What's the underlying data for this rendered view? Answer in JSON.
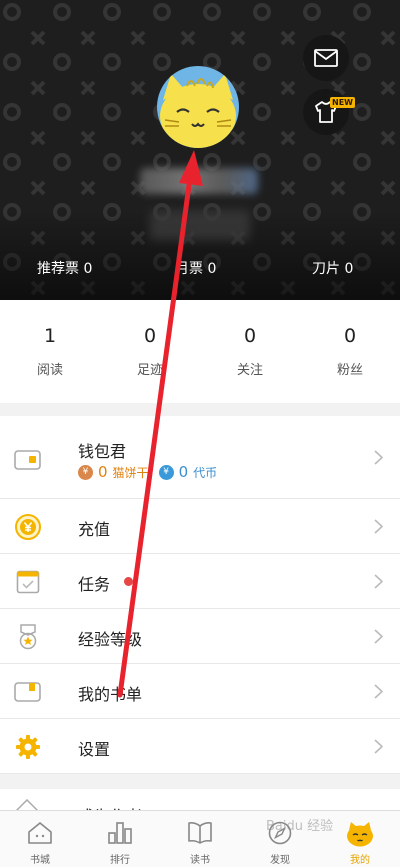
{
  "header": {
    "mail_icon": "envelope-icon",
    "wardrobe_icon": "tshirt-icon",
    "wardrobe_badge": "NEW",
    "tickets": [
      {
        "label": "推荐票",
        "value": "0"
      },
      {
        "label": "月票",
        "value": "0"
      },
      {
        "label": "刀片",
        "value": "0"
      }
    ]
  },
  "stats": [
    {
      "value": "1",
      "label": "阅读"
    },
    {
      "value": "0",
      "label": "足迹"
    },
    {
      "value": "0",
      "label": "关注"
    },
    {
      "value": "0",
      "label": "粉丝"
    }
  ],
  "menu": {
    "wallet": {
      "label": "钱包君",
      "cat_coin_value": "0",
      "cat_coin_label": "猫饼干",
      "dai_coin_value": "0",
      "dai_coin_label": "代币",
      "coin_glyph": "¥"
    },
    "recharge": "充值",
    "tasks": "任务",
    "level": "经验等级",
    "booklist": "我的书单",
    "settings": "设置",
    "partial": "成为作者"
  },
  "tabbar": [
    {
      "label": "书城",
      "icon": "house-icon"
    },
    {
      "label": "排行",
      "icon": "bars-icon"
    },
    {
      "label": "读书",
      "icon": "book-icon"
    },
    {
      "label": "发现",
      "icon": "compass-icon"
    },
    {
      "label": "我的",
      "icon": "cat-avatar-icon"
    }
  ],
  "watermark": "Baidu 经验",
  "colors": {
    "accent": "#f5b400",
    "annotation_arrow": "#e8232e",
    "header_bg": "#1e1e1e"
  }
}
